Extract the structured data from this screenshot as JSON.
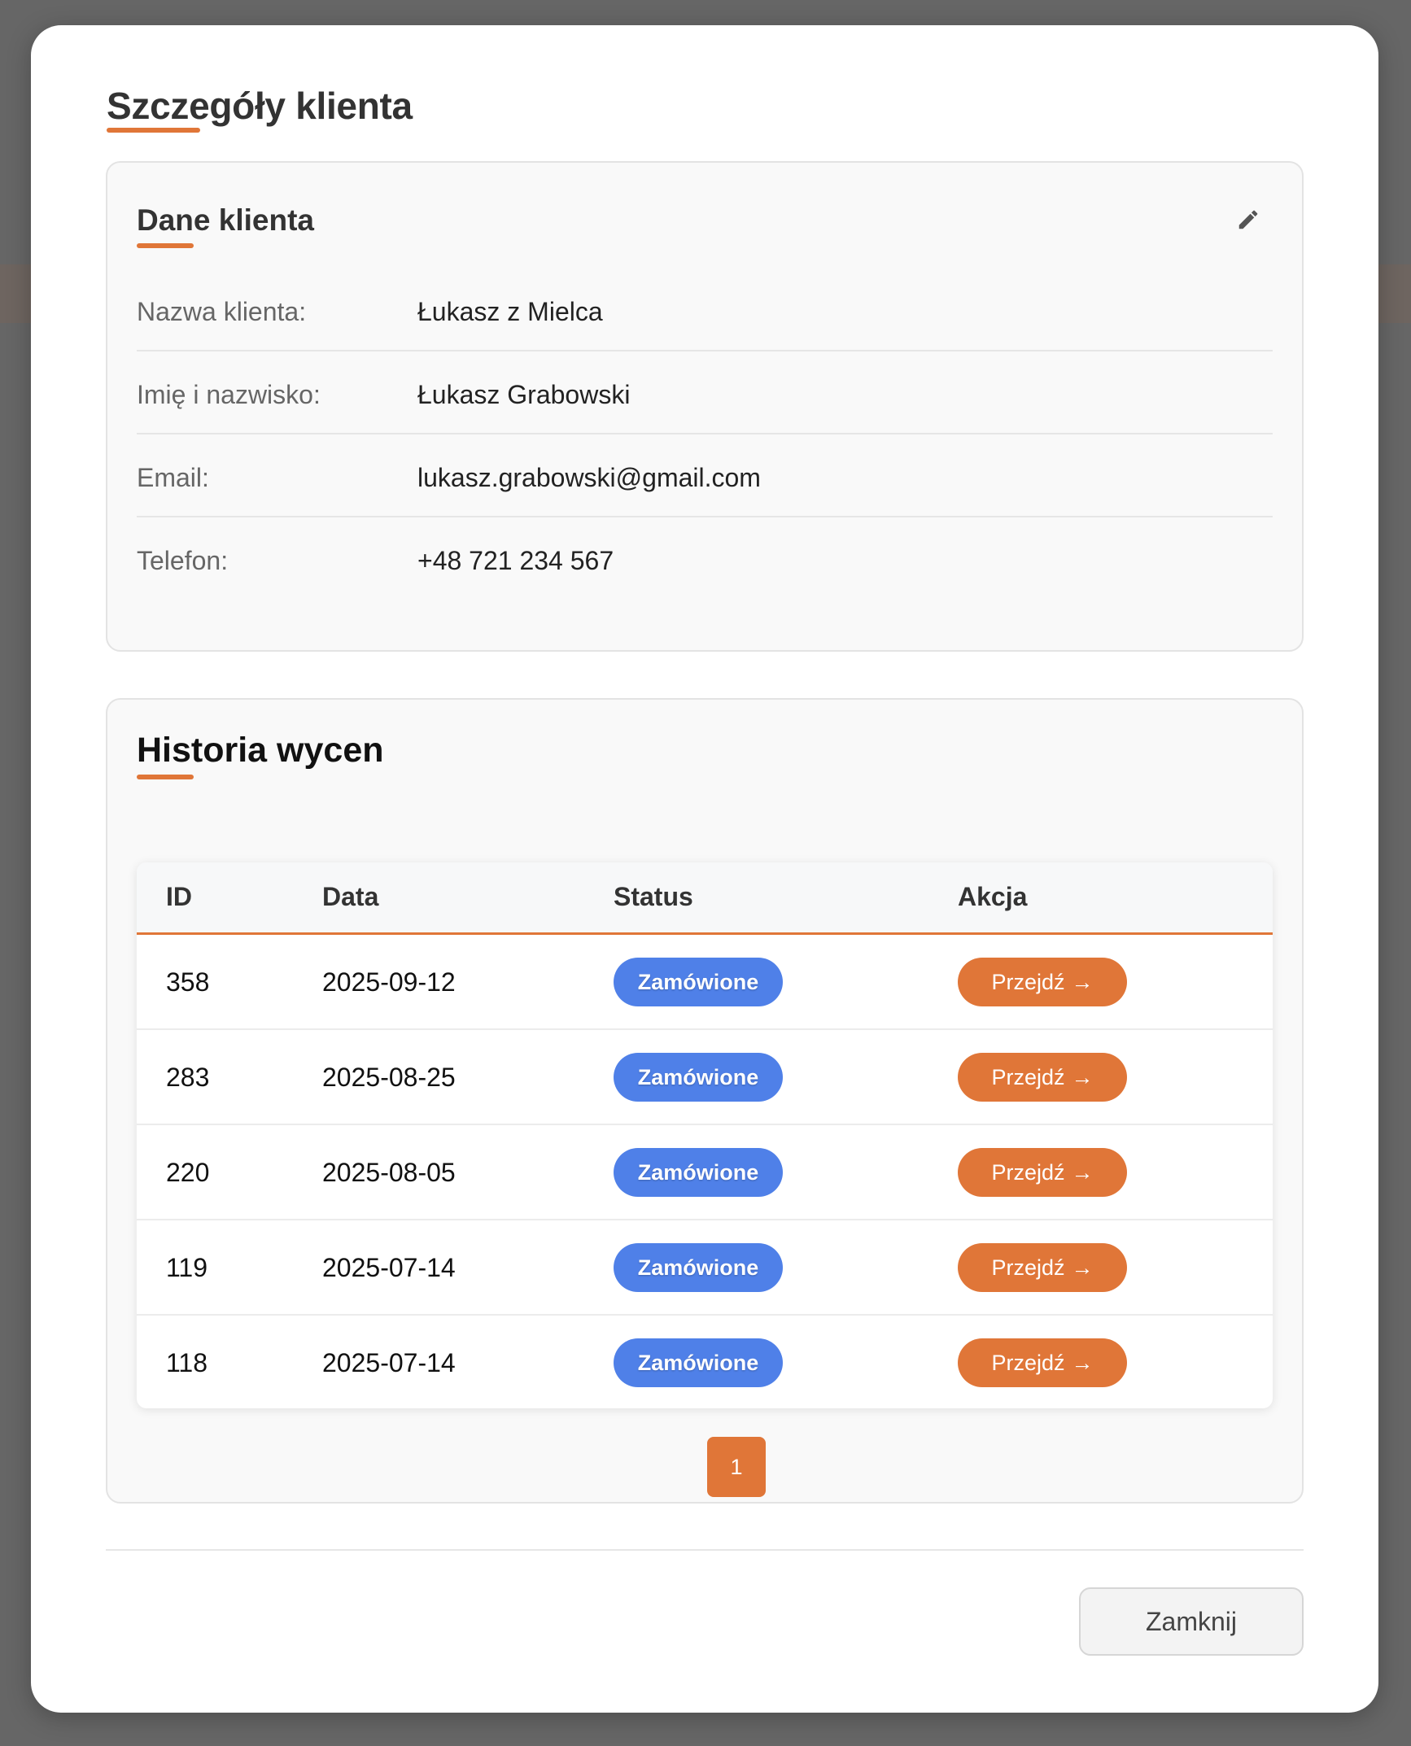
{
  "modal": {
    "title": "Szczegóły klienta",
    "close_label": "Zamknij"
  },
  "client_card": {
    "title": "Dane klienta",
    "edit_icon": "pencil-icon",
    "fields": [
      {
        "label": "Nazwa klienta:",
        "value": "Łukasz z Mielca"
      },
      {
        "label": "Imię i nazwisko:",
        "value": "Łukasz Grabowski"
      },
      {
        "label": "Email:",
        "value": "lukasz.grabowski@gmail.com"
      },
      {
        "label": "Telefon:",
        "value": "+48 721 234 567"
      }
    ]
  },
  "history_card": {
    "title": "Historia wycen",
    "columns": [
      "ID",
      "Data",
      "Status",
      "Akcja"
    ],
    "rows": [
      {
        "id": "358",
        "date": "2025-09-12",
        "status": "Zamówione",
        "action": "Przejdź"
      },
      {
        "id": "283",
        "date": "2025-08-25",
        "status": "Zamówione",
        "action": "Przejdź"
      },
      {
        "id": "220",
        "date": "2025-08-05",
        "status": "Zamówione",
        "action": "Przejdź"
      },
      {
        "id": "119",
        "date": "2025-07-14",
        "status": "Zamówione",
        "action": "Przejdź"
      },
      {
        "id": "118",
        "date": "2025-07-14",
        "status": "Zamówione",
        "action": "Przejdź"
      }
    ],
    "action_arrow": "→",
    "pagination": {
      "current_page": "1"
    }
  },
  "colors": {
    "accent": "#e07638",
    "status_badge": "#4f80e8",
    "backdrop": "#666666"
  }
}
